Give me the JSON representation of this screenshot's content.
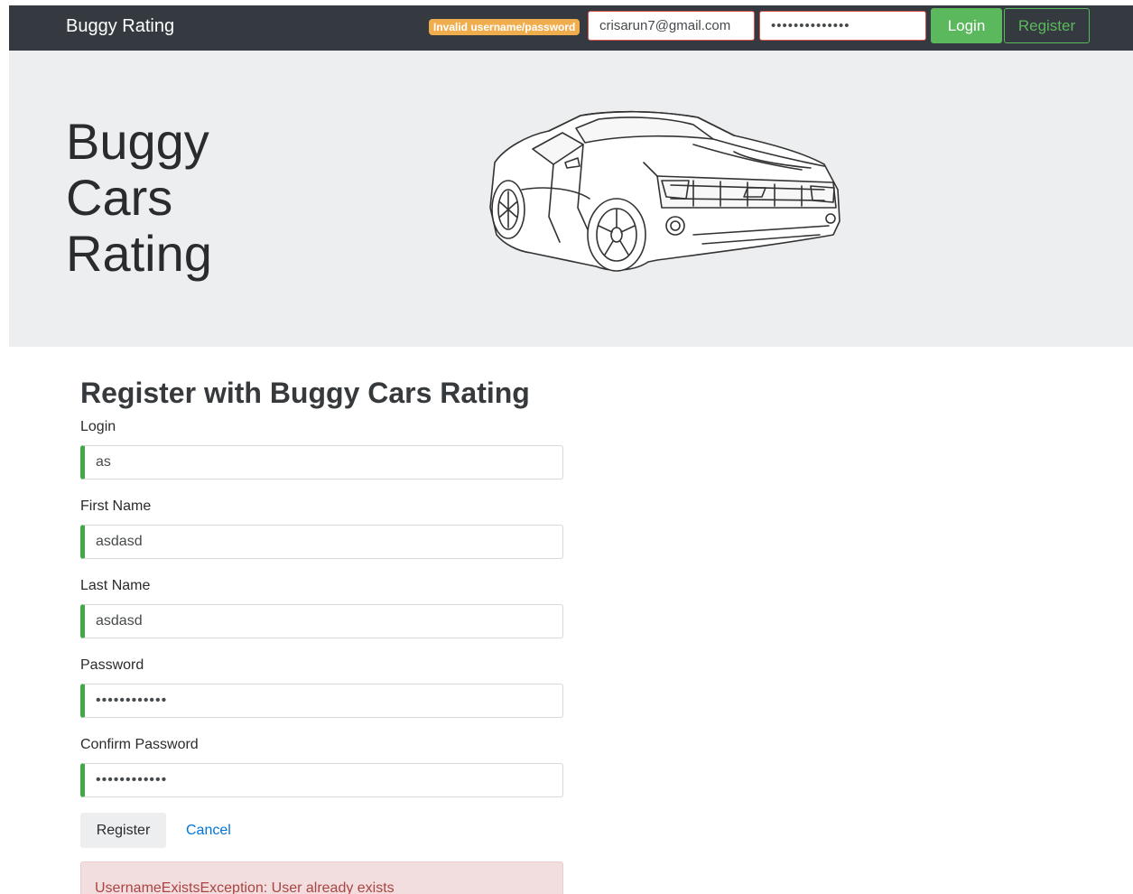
{
  "navbar": {
    "brand": "Buggy Rating",
    "error_badge": "Invalid username/password",
    "username_value": "crisarun7@gmail.com",
    "password_value": "••••••••••••••",
    "login_label": "Login",
    "register_label": "Register",
    "colors": {
      "background": "#343a40",
      "badge": "#f0ad4e",
      "success": "#5cb85c",
      "error_border": "#d9534f"
    }
  },
  "hero": {
    "title_lines": [
      "Buggy",
      "Cars",
      "Rating"
    ],
    "image": "car-sketch"
  },
  "form": {
    "title": "Register with Buggy Cars Rating",
    "fields": [
      {
        "label": "Login",
        "value": "as"
      },
      {
        "label": "First Name",
        "value": "asdasd"
      },
      {
        "label": "Last Name",
        "value": "asdasd"
      },
      {
        "label": "Password",
        "value": "••••••••••••"
      },
      {
        "label": "Confirm Password",
        "value": "••••••••••••"
      }
    ],
    "register_label": "Register",
    "cancel_label": "Cancel",
    "error_message": "UsernameExistsException: User already exists",
    "colors": {
      "valid_border": "#42a948",
      "link": "#0275d8",
      "alert_bg": "#f2dede",
      "alert_text": "#a94442"
    }
  }
}
